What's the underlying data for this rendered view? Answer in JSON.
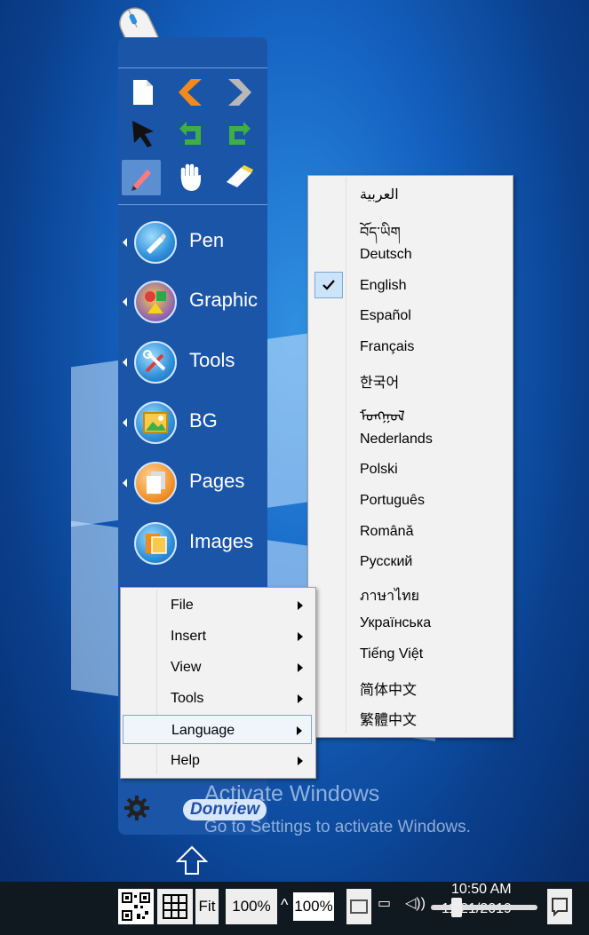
{
  "toolbar": {
    "categories": [
      {
        "label": "Pen",
        "icon": "pen-icon"
      },
      {
        "label": "Graphic",
        "icon": "graphic-icon"
      },
      {
        "label": "Tools",
        "icon": "tools-icon"
      },
      {
        "label": "BG",
        "icon": "background-icon"
      },
      {
        "label": "Pages",
        "icon": "pages-icon"
      },
      {
        "label": "Images",
        "icon": "images-icon"
      }
    ],
    "brand": "Donview"
  },
  "context_menu": {
    "items": [
      {
        "label": "File"
      },
      {
        "label": "Insert"
      },
      {
        "label": "View"
      },
      {
        "label": "Tools"
      },
      {
        "label": "Language"
      },
      {
        "label": "Help"
      }
    ],
    "highlighted": "Language"
  },
  "language_menu": {
    "items": [
      {
        "label": "العربية"
      },
      {
        "label": "བོད་ཡིག"
      },
      {
        "label": "Deutsch"
      },
      {
        "label": "English"
      },
      {
        "label": "Español"
      },
      {
        "label": "Français"
      },
      {
        "label": "한국어"
      },
      {
        "label": "ᠮᠣᠩᠭᠣᠯ"
      },
      {
        "label": "Nederlands"
      },
      {
        "label": "Polski"
      },
      {
        "label": "Português"
      },
      {
        "label": "Română"
      },
      {
        "label": "Русский"
      },
      {
        "label": "ภาษาไทย"
      },
      {
        "label": "Українська"
      },
      {
        "label": "Tiếng Việt"
      },
      {
        "label": "简体中文"
      },
      {
        "label": "繁體中文"
      }
    ],
    "checked": "English"
  },
  "watermark": {
    "line1": "Activate Windows",
    "line2": "Go to Settings to activate Windows."
  },
  "taskbar": {
    "fit_label": "Fit",
    "zoom1": "100%",
    "zoom2": "100%",
    "time": "10:50 AM",
    "date": "11/21/2019"
  }
}
